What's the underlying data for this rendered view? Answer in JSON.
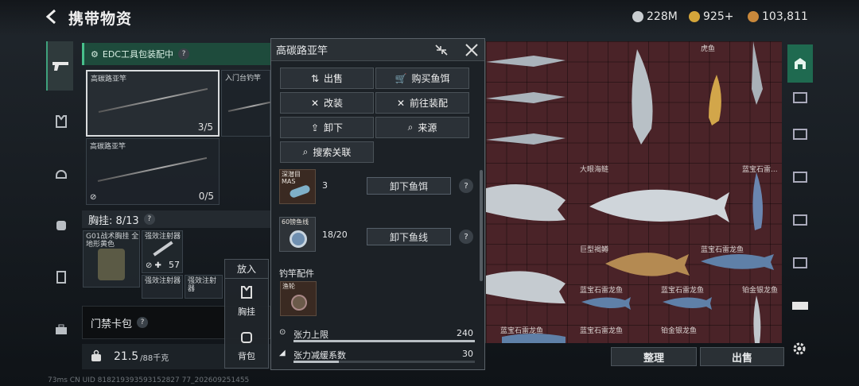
{
  "header": {
    "title": "携带物资",
    "currencies": [
      {
        "icon": "silver-coin-icon",
        "value": "228M",
        "color": "#c9cdd1"
      },
      {
        "icon": "gold-coin-icon",
        "value": "925+",
        "color": "#d4a53a"
      },
      {
        "icon": "bronze-coin-icon",
        "value": "103,811",
        "color": "#c9883b"
      }
    ]
  },
  "left_nav": [
    "pistol-icon",
    "vest-icon",
    "helmet-icon",
    "backpack-icon",
    "case-icon",
    "toolbox-icon"
  ],
  "loadout": {
    "edc_label": "EDC工具包装配中",
    "slots": [
      {
        "name": "高碳路亚竿",
        "count": "3/5"
      },
      {
        "name": "入门台钓竿",
        "count": ""
      },
      {
        "name": "高碳路亚竿",
        "count": "0/5"
      }
    ],
    "vest_label": "胸挂: 8/13",
    "vest_items": [
      {
        "name": "G01战术胸挂 全地形黄色"
      },
      {
        "name": "强效注射器",
        "count": "57"
      },
      {
        "name": "强效注射器"
      },
      {
        "name": "强效注射器"
      }
    ],
    "keycard_label": "门禁卡包",
    "weight": "21.5",
    "weight_unit": "/88千克"
  },
  "put_in": {
    "title": "放入",
    "options": [
      "胸挂",
      "背包"
    ]
  },
  "popup": {
    "title": "高碳路亚竿",
    "buttons": [
      "出售",
      "购买鱼饵",
      "改装",
      "前往装配",
      "卸下",
      "来源",
      "搜索关联"
    ],
    "bait": {
      "name": "深潜目 MAS",
      "count": "3",
      "action": "卸下鱼饵"
    },
    "line": {
      "name": "60镑鱼线",
      "count": "18/20",
      "action": "卸下鱼线"
    },
    "accessories_label": "钓竿配件",
    "reel_name": "渔轮",
    "stats": [
      {
        "label": "张力上限",
        "value": "240",
        "fill": 1.0
      },
      {
        "label": "张力减缓系数",
        "value": "30",
        "fill": 0.25
      }
    ]
  },
  "grid": {
    "labels": [
      "虎鱼",
      "大眼海鲢",
      "蓝宝石雷...",
      "巨型褐鳟",
      "蓝宝石雷龙鱼",
      "蓝宝石雷龙鱼",
      "蓝宝石雷龙鱼",
      "铂金银龙鱼",
      "蓝宝石雷龙鱼",
      "蓝宝石雷龙鱼",
      "铂金银龙鱼"
    ]
  },
  "actions": {
    "sort": "整理",
    "sell": "出售"
  },
  "footer": "73ms   CN UID 818219393593152827 77_202609251455"
}
